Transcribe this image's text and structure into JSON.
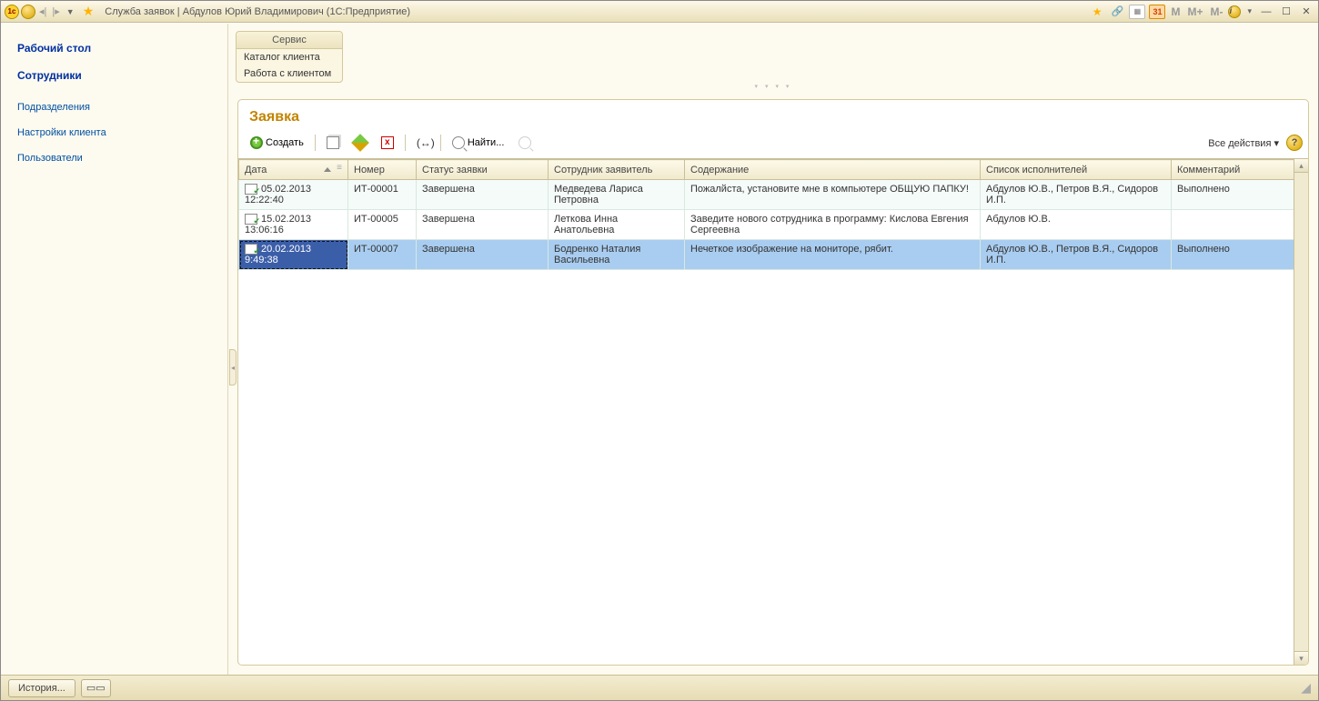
{
  "title": "Служба заявок | Абдулов Юрий Владимирович  (1С:Предприятие)",
  "top_icons": {
    "m": "M",
    "mplus": "M+",
    "mminus": "M-",
    "cal": "31"
  },
  "sidebar": {
    "items": [
      {
        "label": "Рабочий стол",
        "bold": true
      },
      {
        "label": "Сотрудники",
        "bold": true
      },
      {
        "label": "Подразделения",
        "bold": false
      },
      {
        "label": "Настройки клиента",
        "bold": false
      },
      {
        "label": "Пользователи",
        "bold": false
      }
    ]
  },
  "service": {
    "header": "Сервис",
    "items": [
      "Каталог клиента",
      "Работа с клиентом"
    ]
  },
  "page": {
    "heading": "Заявка",
    "create": "Создать",
    "find": "Найти...",
    "all_actions": "Все действия"
  },
  "columns": [
    "Дата",
    "Номер",
    "Статус заявки",
    "Сотрудник заявитель",
    "Содержание",
    "Список исполнителей",
    "Комментарий"
  ],
  "rows": [
    {
      "date": "05.02.2013 12:22:40",
      "num": "ИТ-00001",
      "status": "Завершена",
      "emp": "Медведева Лариса Петровна",
      "content": "Пожалйста, установите мне в компьютере ОБЩУЮ ПАПКУ!",
      "exec": "Абдулов Ю.В., Петров В.Я., Сидоров И.П.",
      "comment": "Выполнено"
    },
    {
      "date": "15.02.2013 13:06:16",
      "num": "ИТ-00005",
      "status": "Завершена",
      "emp": "Леткова Инна Анатольевна",
      "content": "Заведите нового сотрудника в программу: Кислова Евгения Сергеевна",
      "exec": "Абдулов Ю.В.",
      "comment": ""
    },
    {
      "date": "20.02.2013 9:49:38",
      "num": "ИТ-00007",
      "status": "Завершена",
      "emp": "Бодренко Наталия Васильевна",
      "content": "Нечеткое изображение на мониторе, рябит.",
      "exec": "Абдулов Ю.В., Петров В.Я., Сидоров И.П.",
      "comment": "Выполнено"
    }
  ],
  "footer": {
    "history": "История..."
  }
}
